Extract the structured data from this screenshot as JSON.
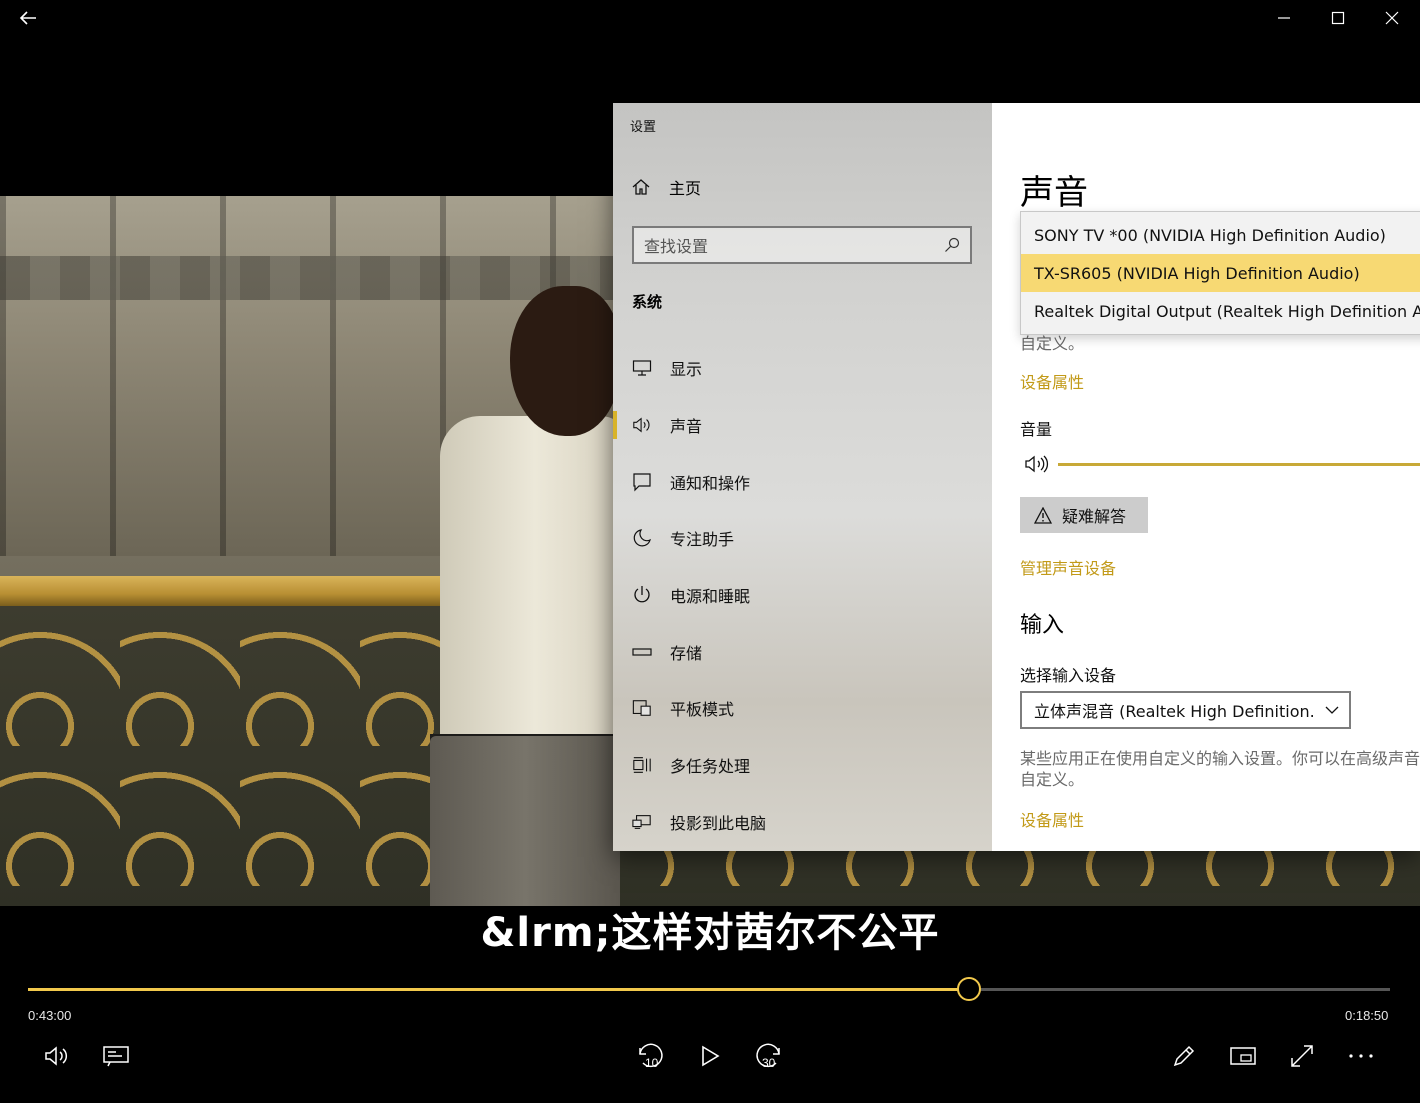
{
  "player": {
    "subtitle": "&lrm;这样对茜尔不公平",
    "time_elapsed": "0:43:00",
    "time_remaining": "0:18:50",
    "progress": 0.691,
    "accent_color": "#f2c94c",
    "skip_back_label": "10",
    "skip_forward_label": "30",
    "icons": {
      "back": "back-arrow-icon",
      "minimize": "minimize-icon",
      "maximize": "maximize-icon",
      "close": "close-icon",
      "volume": "volume-icon",
      "captions": "captions-icon",
      "skip_back": "skip-back-icon",
      "play": "play-icon",
      "skip_forward": "skip-forward-icon",
      "edit": "pencil-icon",
      "mini_view": "mini-view-icon",
      "fullscreen": "fullscreen-icon",
      "more": "more-icon"
    }
  },
  "settings": {
    "window_title": "设置",
    "home_label": "主页",
    "search_placeholder": "查找设置",
    "section_title": "系统",
    "nav_items": [
      {
        "label": "显示",
        "icon": "monitor-icon"
      },
      {
        "label": "声音",
        "icon": "speaker-icon",
        "active": true
      },
      {
        "label": "通知和操作",
        "icon": "notification-icon"
      },
      {
        "label": "专注助手",
        "icon": "moon-icon"
      },
      {
        "label": "电源和睡眠",
        "icon": "power-icon"
      },
      {
        "label": "存储",
        "icon": "storage-icon"
      },
      {
        "label": "平板模式",
        "icon": "tablet-mode-icon"
      },
      {
        "label": "多任务处理",
        "icon": "multitasking-icon"
      },
      {
        "label": "投影到此电脑",
        "icon": "project-icon"
      }
    ],
    "page_title": "声音",
    "output_options": [
      "SONY TV  *00 (NVIDIA High Definition Audio)",
      "TX-SR605 (NVIDIA High Definition Audio)",
      "Realtek Digital Output (Realtek High Definition Audio)"
    ],
    "output_selected_index": 1,
    "output_hint_tail": "自定义。",
    "output_device_properties": "设备属性",
    "volume_label": "音量",
    "troubleshoot_label": "疑难解答",
    "manage_devices_link": "管理声音设备",
    "input_title": "输入",
    "input_select_label": "选择输入设备",
    "input_selected": "立体声混音 (Realtek High Definition...",
    "input_hint_line1": "某些应用正在使用自定义的输入设置。你可以在高级声音",
    "input_hint_line2": "自定义。",
    "input_device_properties": "设备属性",
    "link_color": "#c29a18",
    "highlight_color": "#f7d973"
  }
}
